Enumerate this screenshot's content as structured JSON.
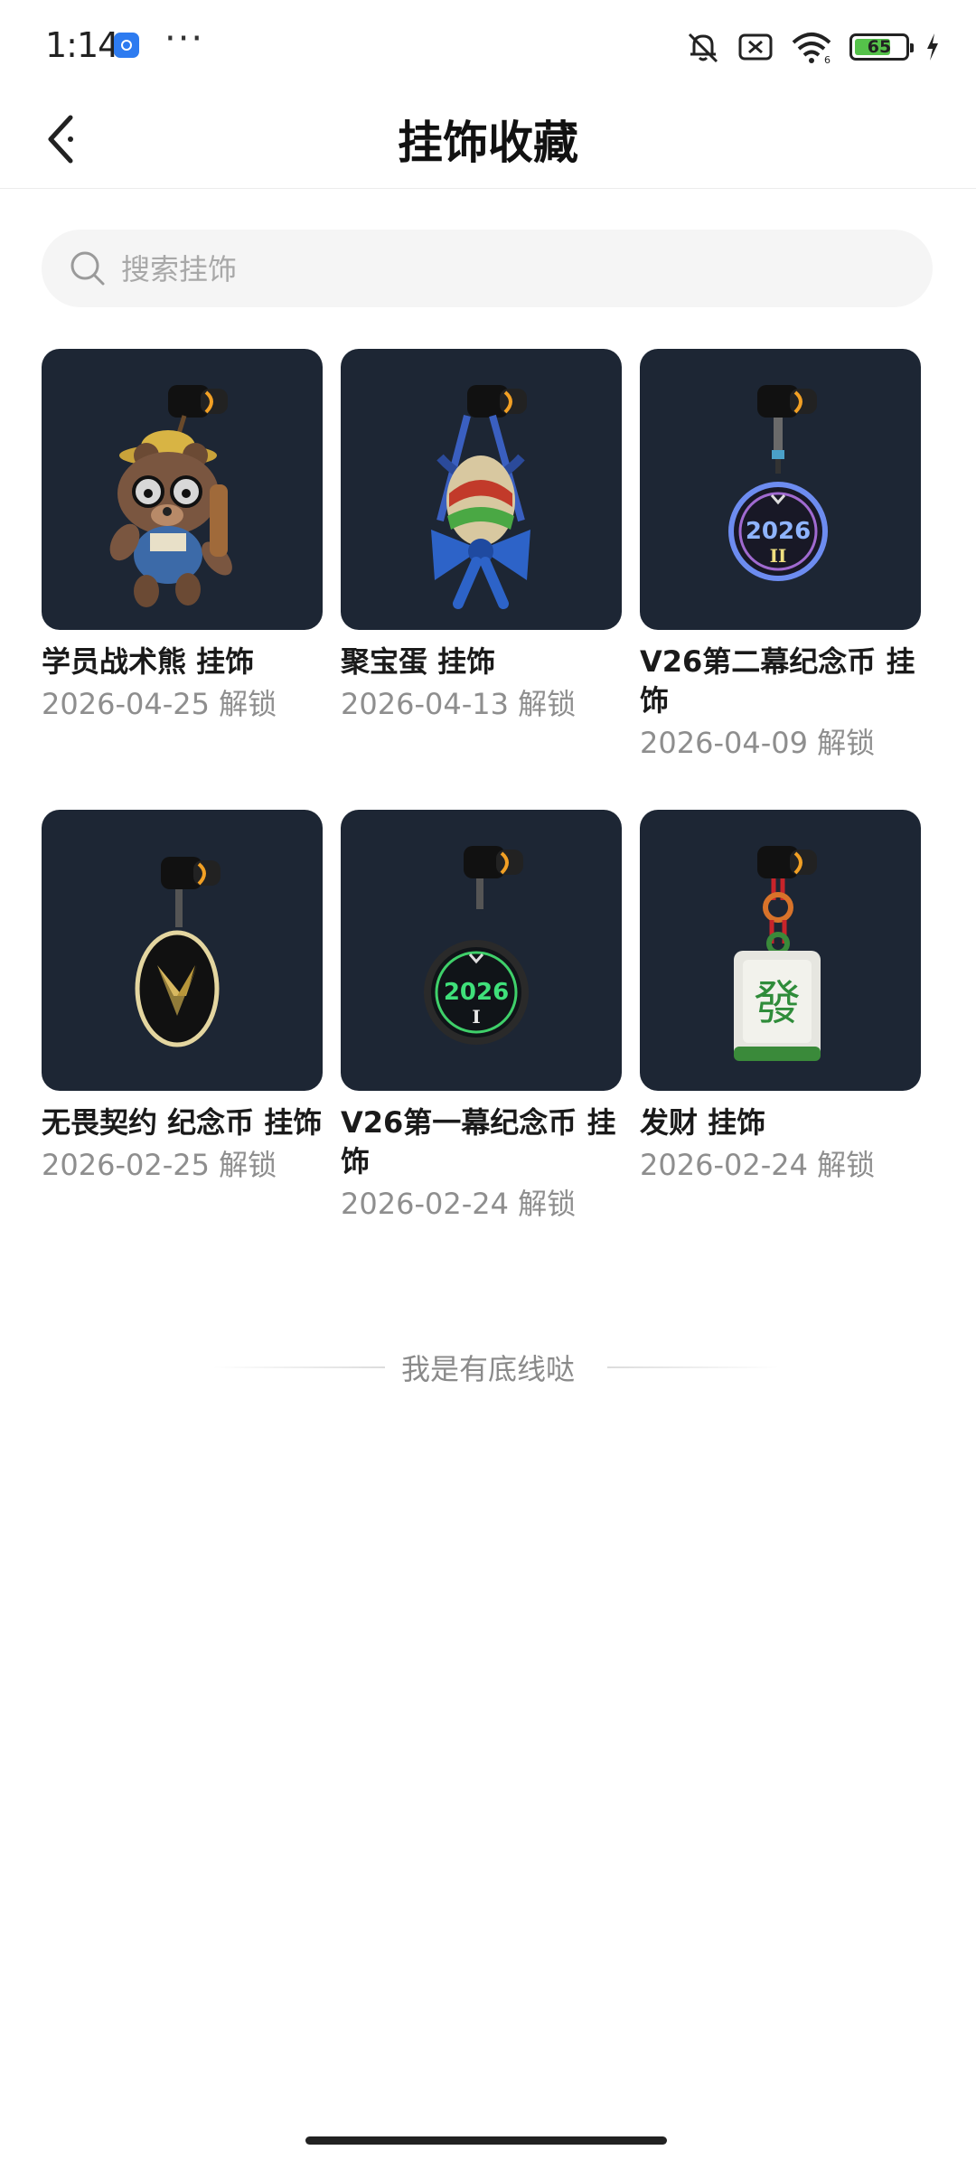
{
  "status_bar": {
    "time": "1:14",
    "more": "···",
    "battery": "65",
    "icons": [
      "bell-muted-icon",
      "sim-off-icon",
      "wifi-icon",
      "battery-icon",
      "charging-icon"
    ]
  },
  "header": {
    "title": "挂饰收藏",
    "back_icon": "chevron-left-icon"
  },
  "search": {
    "placeholder": "搜索挂饰",
    "value": ""
  },
  "items": [
    {
      "name": "学员战术熊 挂饰",
      "date": "2026-04-25 解锁",
      "thumb": "bear-charm"
    },
    {
      "name": "聚宝蛋 挂饰",
      "date": "2026-04-13 解锁",
      "thumb": "egg-charm"
    },
    {
      "name": "V26第二幕纪念币 挂饰",
      "date": "2026-04-09 解锁",
      "thumb": "coin-2026-ii",
      "coin_year": "2026",
      "coin_act": "II"
    },
    {
      "name": "无畏契约 纪念币 挂饰",
      "date": "2026-02-25 解锁",
      "thumb": "valorant-coin"
    },
    {
      "name": "V26第一幕纪念币 挂饰",
      "date": "2026-02-24 解锁",
      "thumb": "coin-2026-i",
      "coin_year": "2026",
      "coin_act": "I"
    },
    {
      "name": "发财 挂饰",
      "date": "2026-02-24 解锁",
      "thumb": "mahjong-charm",
      "tile_char": "發"
    }
  ],
  "footer": {
    "end_text": "我是有底线哒"
  },
  "colors": {
    "card_bg": "#1d2634",
    "accent_orange": "#f2a024",
    "coin_blue": "#6d8cf0",
    "coin_green": "#3fd06a",
    "mahjong_green": "#2f8c3a"
  }
}
